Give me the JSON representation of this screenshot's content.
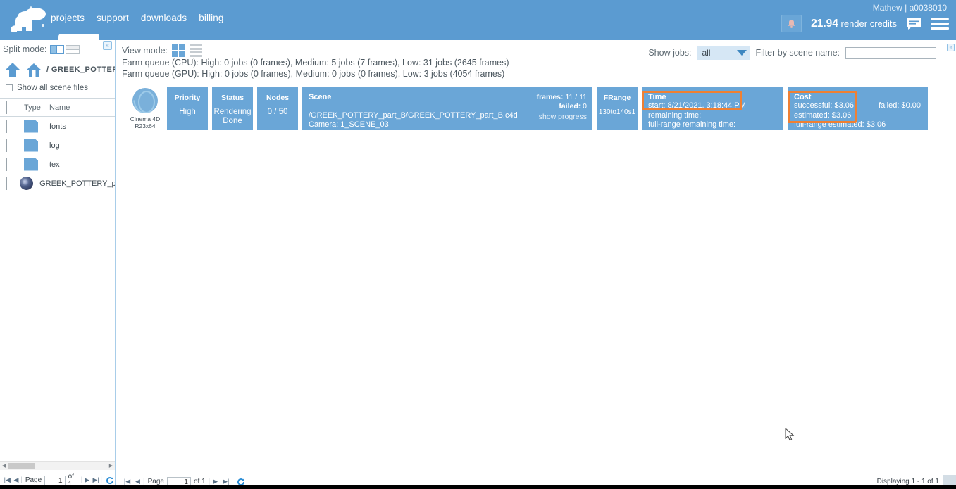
{
  "header": {
    "logo_name": "cloud-render-logo",
    "nav": [
      {
        "label": "projects"
      },
      {
        "label": "support"
      },
      {
        "label": "downloads"
      },
      {
        "label": "billing"
      }
    ],
    "user": "Mathew | a0038010",
    "credits_value": "21.94",
    "credits_label": "render credits",
    "bell_icon": "bell-icon",
    "chat_icon": "chat-icon",
    "menu_icon": "hamburger-icon",
    "accent": "#5b9bd1"
  },
  "left_panel": {
    "split_mode_label": "Split mode:",
    "collapse_label": "«",
    "breadcrumb": "/ GREEK_POTTERY_",
    "show_all_label": "Show all scene files",
    "columns": [
      "Type",
      "Name"
    ],
    "rows": [
      {
        "type": "folder",
        "name": "fonts"
      },
      {
        "type": "folder",
        "name": "log"
      },
      {
        "type": "folder",
        "name": "tex"
      },
      {
        "type": "c4d",
        "name": "GREEK_POTTERY_part_B."
      }
    ],
    "pager": {
      "first": "⏮",
      "prev": "◀",
      "page_label": "Page",
      "page_value": "1",
      "of_label": "of 1",
      "next": "▶",
      "last": "⏭",
      "refresh": "refresh-icon"
    }
  },
  "main": {
    "view_mode_label": "View mode:",
    "farm_queue_cpu": "Farm queue (CPU): High: 0 jobs (0 frames), Medium: 5 jobs (7 frames), Low: 31 jobs (2645 frames)",
    "farm_queue_gpu": "Farm queue (GPU): High: 0 jobs (0 frames), Medium: 0 jobs (0 frames), Low: 3 jobs (4054 frames)",
    "show_jobs_label": "Show jobs:",
    "show_jobs_value": "all",
    "filter_label": "Filter by scene name:",
    "filter_value": "",
    "filter_placeholder": "",
    "collapse_label": "«",
    "job": {
      "app_name_line1": "Cinema 4D",
      "app_name_line2": "R23x64",
      "priority_title": "Priority",
      "priority_value": "High",
      "status_title": "Status",
      "status_value_l1": "Rendering",
      "status_value_l2": "Done",
      "nodes_title": "Nodes",
      "nodes_value": "0 / 50",
      "scene_title": "Scene",
      "scene_path": "/GREEK_POTTERY_part_B/GREEK_POTTERY_part_B.c4d",
      "scene_camera": "Camera: 1_SCENE_03",
      "frames_label": "frames:",
      "frames_value": "11 / 11",
      "failed_label": "failed:",
      "failed_value": "0",
      "show_progress": "show progress",
      "frange_title": "FRange",
      "frange_value": "130to140s1",
      "time_title": "Time",
      "time_start": "start: 8/21/2021, 3:18:44 PM",
      "time_remaining": "remaining time:",
      "time_full_range": "full-range remaining time:",
      "cost_title": "Cost",
      "cost_successful": "successful: $3.06",
      "cost_estimated": "estimated: $3.06",
      "cost_full_range": "full-range estimated: $3.06",
      "cost_failed": "failed: $0.00",
      "highlight_color": "#ef8033"
    },
    "pager": {
      "first": "⏮",
      "prev": "◀",
      "page_label": "Page",
      "page_value": "1",
      "of_label": "of 1",
      "next": "▶",
      "last": "⏭",
      "refresh": "refresh-icon"
    },
    "displaying": "Displaying 1 - 1 of 1"
  }
}
